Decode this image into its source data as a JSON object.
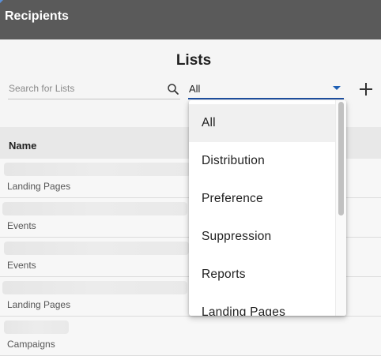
{
  "header": {
    "title": "Recipients"
  },
  "lists": {
    "title": "Lists",
    "search": {
      "placeholder": "Search for Lists"
    },
    "filter": {
      "selected": "All"
    }
  },
  "table": {
    "column_name": "Name",
    "rows": [
      {
        "type": "Landing Pages"
      },
      {
        "type": "Events"
      },
      {
        "type": "Events"
      },
      {
        "type": "Landing Pages"
      },
      {
        "type": "Campaigns"
      }
    ]
  },
  "dropdown": {
    "options": [
      "All",
      "Distribution",
      "Preference",
      "Suppression",
      "Reports",
      "Landing Pages"
    ],
    "selected": "All"
  },
  "colors": {
    "header_bg": "#5a5a5a",
    "accent": "#1e4fa0",
    "panel_bg": "#f5f5f5"
  },
  "icons": {
    "search": "search-icon",
    "add": "plus-icon",
    "dropdown_arrow": "triangle-down-icon"
  }
}
